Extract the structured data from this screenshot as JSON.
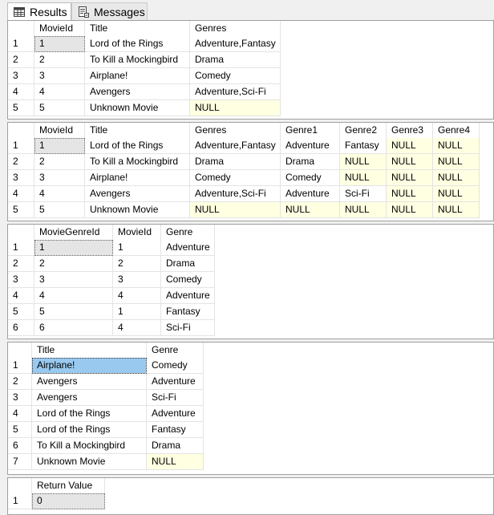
{
  "tabs": [
    {
      "label": "Results",
      "icon": "grid-icon"
    },
    {
      "label": "Messages",
      "icon": "messages-icon"
    }
  ],
  "grids": [
    {
      "headers": [
        "MovieId",
        "Title",
        "Genres"
      ],
      "rows": [
        [
          "1",
          "1",
          "Lord of the Rings",
          "Adventure,Fantasy"
        ],
        [
          "2",
          "2",
          "To Kill a Mockingbird",
          "Drama"
        ],
        [
          "3",
          "3",
          "Airplane!",
          "Comedy"
        ],
        [
          "4",
          "4",
          "Avengers",
          "Adventure,Sci-Fi"
        ],
        [
          "5",
          "5",
          "Unknown Movie",
          "NULL"
        ]
      ]
    },
    {
      "headers": [
        "MovieId",
        "Title",
        "Genres",
        "Genre1",
        "Genre2",
        "Genre3",
        "Genre4"
      ],
      "rows": [
        [
          "1",
          "1",
          "Lord of the Rings",
          "Adventure,Fantasy",
          "Adventure",
          "Fantasy",
          "NULL",
          "NULL"
        ],
        [
          "2",
          "2",
          "To Kill a Mockingbird",
          "Drama",
          "Drama",
          "NULL",
          "NULL",
          "NULL"
        ],
        [
          "3",
          "3",
          "Airplane!",
          "Comedy",
          "Comedy",
          "NULL",
          "NULL",
          "NULL"
        ],
        [
          "4",
          "4",
          "Avengers",
          "Adventure,Sci-Fi",
          "Adventure",
          "Sci-Fi",
          "NULL",
          "NULL"
        ],
        [
          "5",
          "5",
          "Unknown Movie",
          "NULL",
          "NULL",
          "NULL",
          "NULL",
          "NULL"
        ]
      ]
    },
    {
      "headers": [
        "MovieGenreId",
        "MovieId",
        "Genre"
      ],
      "rows": [
        [
          "1",
          "1",
          "1",
          "Adventure"
        ],
        [
          "2",
          "2",
          "2",
          "Drama"
        ],
        [
          "3",
          "3",
          "3",
          "Comedy"
        ],
        [
          "4",
          "4",
          "4",
          "Adventure"
        ],
        [
          "5",
          "5",
          "1",
          "Fantasy"
        ],
        [
          "6",
          "6",
          "4",
          "Sci-Fi"
        ]
      ]
    },
    {
      "headers": [
        "Title",
        "Genre"
      ],
      "rows": [
        [
          "1",
          "Airplane!",
          "Comedy"
        ],
        [
          "2",
          "Avengers",
          "Adventure"
        ],
        [
          "3",
          "Avengers",
          "Sci-Fi"
        ],
        [
          "4",
          "Lord of the Rings",
          "Adventure"
        ],
        [
          "5",
          "Lord of the Rings",
          "Fantasy"
        ],
        [
          "6",
          "To Kill a Mockingbird",
          "Drama"
        ],
        [
          "7",
          "Unknown Movie",
          "NULL"
        ]
      ]
    },
    {
      "headers": [
        "Return Value"
      ],
      "rows": [
        [
          "1",
          "0"
        ]
      ]
    }
  ]
}
